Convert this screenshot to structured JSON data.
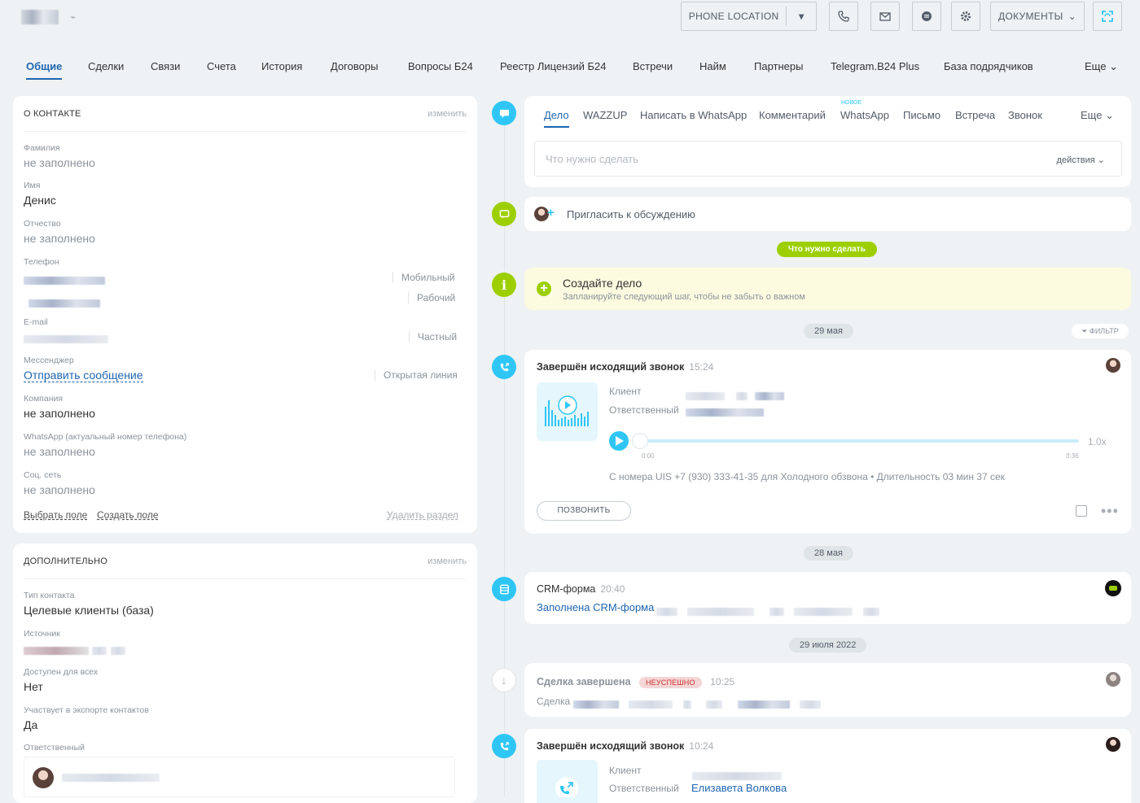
{
  "topbar": {
    "phone_location": "PHONE LOCATION",
    "docs_label": "ДОКУМЕНТЫ"
  },
  "tabs": [
    "Общие",
    "Сделки",
    "Связи",
    "Счета",
    "История",
    "Договоры",
    "Вопросы Б24",
    "Реестр Лицензий Б24",
    "Встречи",
    "Найм",
    "Партнеры",
    "Telegram.B24 Plus",
    "База подрядчиков",
    "Еще"
  ],
  "contact": {
    "title": "О КОНТАКТЕ",
    "edit": "изменить",
    "fields": {
      "lastname_label": "Фамилия",
      "lastname_value": "не заполнено",
      "name_label": "Имя",
      "name_value": "Денис",
      "middlename_label": "Отчество",
      "middlename_value": "не заполнено",
      "phone_label": "Телефон",
      "phone_type1": "Мобильный",
      "phone_type2": "Рабочий",
      "email_label": "E-mail",
      "email_type": "Частный",
      "messenger_label": "Мессенджер",
      "messenger_value": "Отправить сообщение",
      "messenger_type": "Открытая линия",
      "company_label": "Компания",
      "company_value": "не заполнено",
      "whatsapp_label": "WhatsApp (актуальный номер телефона)",
      "whatsapp_value": "не заполнено",
      "social_label": "Соц. сеть",
      "social_value": "не заполнено"
    },
    "choose_field": "Выбрать поле",
    "create_field": "Создать поле",
    "delete_section": "Удалить раздел"
  },
  "additional": {
    "title": "ДОПОЛНИТЕЛЬНО",
    "edit": "изменить",
    "type_label": "Тип контакта",
    "type_value": "Целевые клиенты (база)",
    "source_label": "Источник",
    "available_label": "Доступен для всех",
    "available_value": "Нет",
    "export_label": "Участвует в экспорте контактов",
    "export_value": "Да",
    "responsible_label": "Ответственный"
  },
  "activity": {
    "tabs": [
      "Дело",
      "WAZZUP",
      "Написать в WhatsApp",
      "Комментарий",
      "WhatsApp",
      "Письмо",
      "Встреча",
      "Звонок",
      "Еще"
    ],
    "new_badge": "НОВОЕ",
    "input_placeholder": "Что нужно сделать",
    "actions": "действия"
  },
  "invite": "Пригласить к обсуждению",
  "todo_pill": "Что нужно сделать",
  "create_task": {
    "title": "Создайте дело",
    "subtitle": "Запланируйте следующий шаг, чтобы не забыть о важном"
  },
  "filter": "ФИЛЬТР",
  "dates": [
    "29 мая",
    "28 мая",
    "29 июля 2022"
  ],
  "call1": {
    "title": "Завершён исходящий звонок",
    "time": "15:24",
    "client_label": "Клиент",
    "responsible_label": "Ответственный",
    "speed": "1.0x",
    "t_start": "0:00",
    "t_end": "3:36",
    "info": "С номера UIS +7 (930) 333-41-35 для Холодного обзвона • Длительность 03 мин 37 сек",
    "call_btn": "ПОЗВОНИТЬ"
  },
  "crm_form": {
    "title": "CRM-форма",
    "time": "20:40",
    "link": "Заполнена CRM-форма"
  },
  "deal": {
    "title": "Сделка завершена",
    "badge": "НЕУСПЕШНО",
    "time": "10:25",
    "label": "Сделка"
  },
  "call2": {
    "title": "Завершён исходящий звонок",
    "time": "10:24",
    "client_label": "Клиент",
    "responsible_label": "Ответственный",
    "responsible_name": "Елизавета Волкова"
  },
  "colors": {
    "accent": "#2066b0",
    "call_icon": "#2fc6f6",
    "comment_icon": "#9dcf00",
    "badge_fail": "#f4c7c7"
  }
}
